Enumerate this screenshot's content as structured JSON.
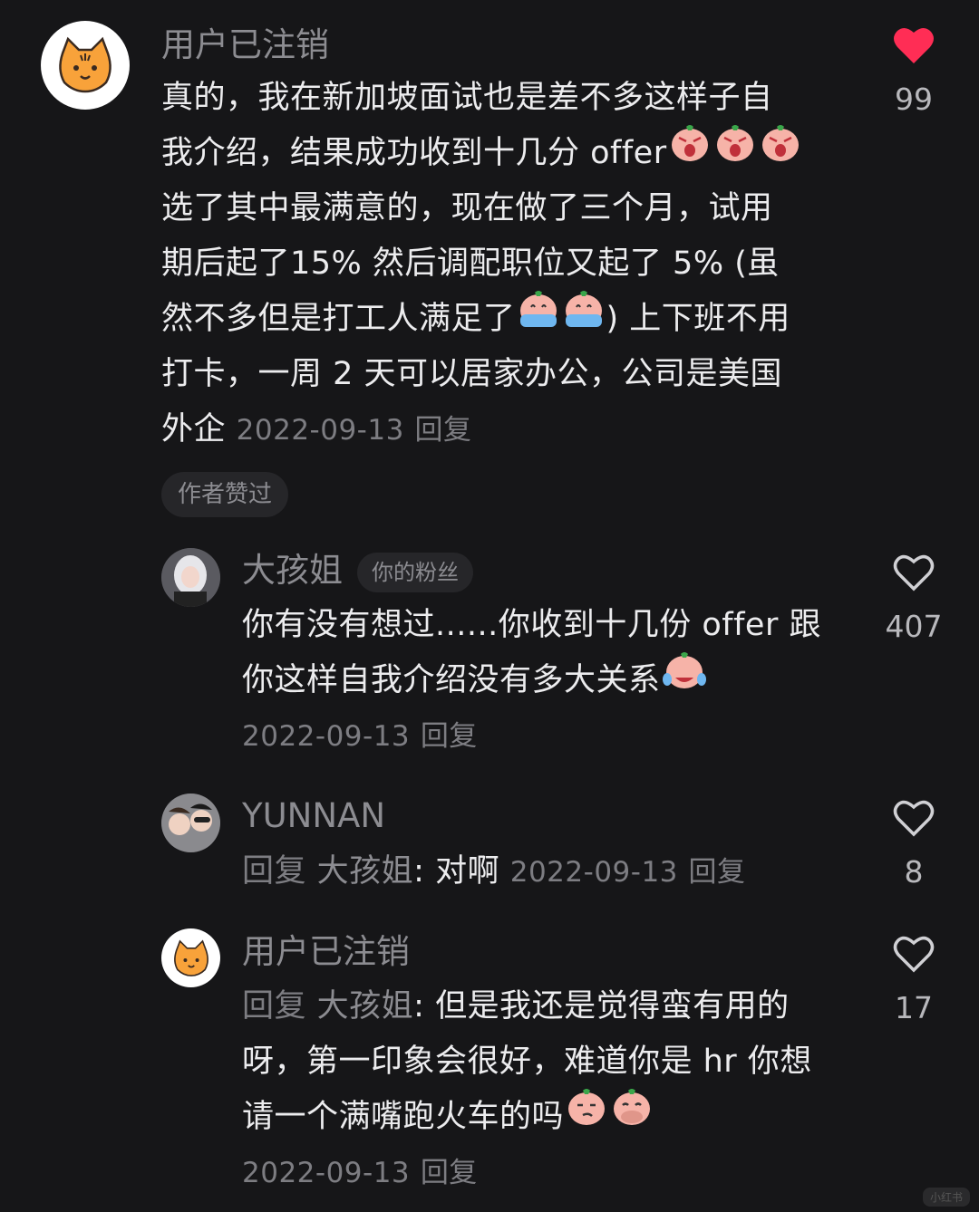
{
  "comments": [
    {
      "username": "用户已注销",
      "body_lines": [
        "真的，我在新加坡面试也是差不多这样子自",
        "我介绍，结果成功收到十几分 offer",
        "选了其中最满意的，现在做了三个月，试用",
        "期后起了15% 然后调配职位又起了 5% (虽",
        "然不多但是打工人满足了",
        "打卡，一周 2 天可以居家办公，公司是美国",
        "外企"
      ],
      "line5_tail": ") 上下班不用",
      "date": "2022-09-13",
      "reply_label": "回复",
      "like_count": "99",
      "liked": true,
      "author_liked_badge": "作者赞过"
    },
    {
      "username": "大孩姐",
      "fan_badge": "你的粉丝",
      "body_lines": [
        "你有没有想过......你收到十几份 offer 跟",
        "你这样自我介绍没有多大关系"
      ],
      "date": "2022-09-13",
      "reply_label": "回复",
      "like_count": "407",
      "liked": false
    },
    {
      "username": "YUNNAN",
      "reply_prefix": "回复",
      "reply_to": "大孩姐",
      "text": ": 对啊",
      "date": "2022-09-13",
      "reply_label": "回复",
      "like_count": "8",
      "liked": false
    },
    {
      "username": "用户已注销",
      "reply_prefix": "回复",
      "reply_to": "大孩姐",
      "first_line_text": ": 但是我还是觉得蛮有用的",
      "body_lines": [
        "呀，第一印象会很好，难道你是 hr 你想",
        "请一个满嘴跑火车的吗"
      ],
      "date": "2022-09-13",
      "reply_label": "回复",
      "like_count": "17",
      "liked": false
    }
  ],
  "icons": {
    "heart_filled_color": "#ff2d55",
    "heart_outline_color": "#d0d0d4"
  },
  "watermark": "小红书"
}
